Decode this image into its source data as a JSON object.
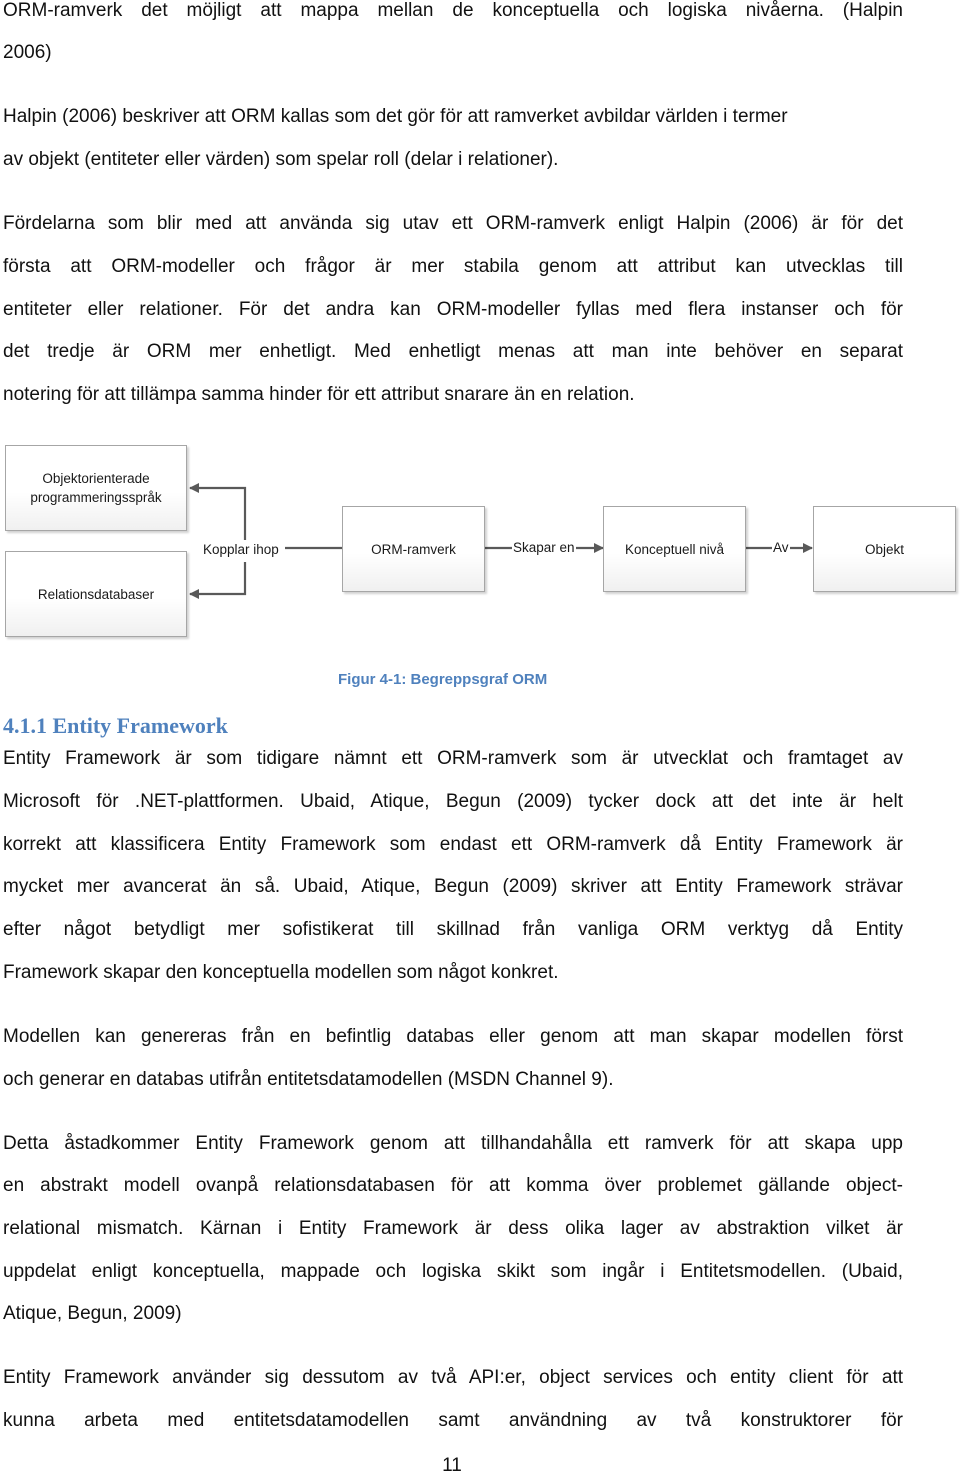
{
  "paragraphs": {
    "p1": [
      "ORM-ramverk det möjligt att mappa mellan de konceptuella och logiska nivåerna. (Halpin",
      "2006)"
    ],
    "p2": [
      "Halpin (2006) beskriver att ORM kallas som det gör för att ramverket avbildar världen i termer",
      "av objekt (entiteter eller värden) som spelar roll (delar i relationer)."
    ],
    "p3": [
      "Fördelarna som blir med att använda sig utav ett ORM-ramverk enligt Halpin (2006) är för det",
      "första att ORM-modeller och frågor är mer stabila genom att attribut kan utvecklas till",
      "entiteter eller relationer. För det andra kan ORM-modeller fyllas med flera instanser och för",
      "det tredje är ORM mer enhetligt. Med enhetligt menas att man inte behöver en separat",
      "notering för att tillämpa samma hinder för ett attribut snarare än en relation."
    ],
    "p4": [
      "Entity Framework är som tidigare nämnt ett ORM-ramverk som är utvecklat och framtaget av",
      "Microsoft för .NET-plattformen. Ubaid, Atique, Begun (2009) tycker dock att det inte är helt",
      "korrekt att klassificera Entity Framework som endast ett ORM-ramverk då Entity Framework är",
      "mycket mer avancerat än så. Ubaid, Atique, Begun (2009) skriver att Entity Framework strävar",
      "efter något betydligt mer sofistikerat till skillnad från vanliga ORM verktyg då Entity",
      "Framework skapar den konceptuella modellen som något konkret."
    ],
    "p5": [
      "Modellen kan genereras från en befintlig databas eller genom att man skapar modellen först",
      "och generar en databas utifrån entitetsdatamodellen (MSDN Channel 9)."
    ],
    "p6": [
      "Detta åstadkommer Entity Framework genom att tillhandahålla ett ramverk för att skapa upp",
      "en abstrakt modell ovanpå relationsdatabasen för att komma över problemet gällande object-",
      "relational mismatch. Kärnan i Entity Framework är dess olika lager av abstraktion vilket är",
      "uppdelat enligt konceptuella, mappade och logiska skikt som ingår i Entitetsmodellen. (Ubaid,",
      "Atique, Begun, 2009)"
    ],
    "p7": [
      "Entity Framework använder sig dessutom av två API:er, object services och entity client för att",
      "kunna arbeta med entitetsdatamodellen samt användning av två konstruktorer för"
    ]
  },
  "diagram": {
    "nodes": {
      "oop": "Objektorienterade programmeringsspråk",
      "rdb": "Relationsdatabaser",
      "orm": "ORM-ramverk",
      "konceptuell": "Konceptuell nivå",
      "objekt": "Objekt"
    },
    "edges": {
      "kopplar": "Kopplar ihop",
      "skapar": "Skapar en",
      "av": "Av"
    },
    "caption": "Figur 4-1: Begreppsgraf ORM"
  },
  "section": {
    "heading": "4.1.1 Entity Framework"
  },
  "page_number": "11",
  "colors": {
    "accent": "#4f81bd",
    "arrow": "#595959"
  }
}
